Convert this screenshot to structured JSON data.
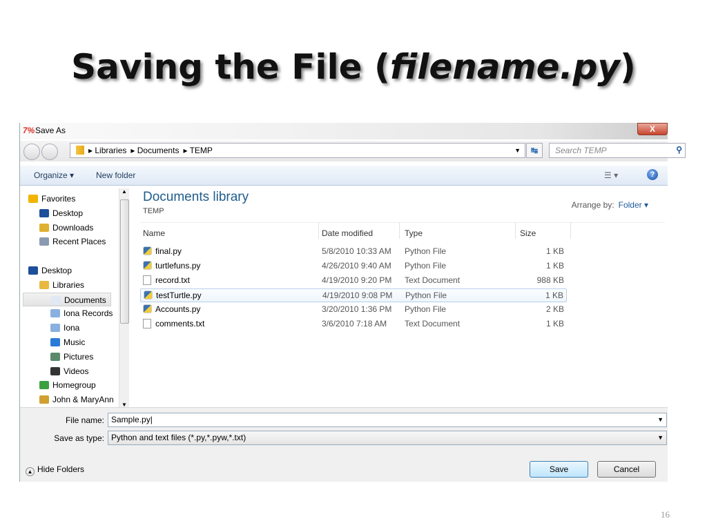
{
  "slide": {
    "title_main": "Saving the File (",
    "title_italic": "filename.py",
    "title_end": ")",
    "page_number": "16"
  },
  "dialog": {
    "title": "Save As",
    "app_icon": "7%",
    "close": "X",
    "breadcrumb": [
      "Libraries",
      "Documents",
      "TEMP"
    ],
    "search_placeholder": "Search TEMP",
    "toolbar": {
      "organize": "Organize ▾",
      "new_folder": "New folder",
      "help": "?"
    },
    "sidebar": [
      {
        "label": "Favorites",
        "indent": 0,
        "color": "#f2b400"
      },
      {
        "label": "Desktop",
        "indent": 1,
        "color": "#1d4f9a"
      },
      {
        "label": "Downloads",
        "indent": 1,
        "color": "#e0b030"
      },
      {
        "label": "Recent Places",
        "indent": 1,
        "color": "#8a9ab0"
      },
      {
        "label": "",
        "indent": 0,
        "color": ""
      },
      {
        "label": "Desktop",
        "indent": 0,
        "color": "#1d4f9a"
      },
      {
        "label": "Libraries",
        "indent": 1,
        "color": "#e8b840"
      },
      {
        "label": "Documents",
        "indent": 2,
        "color": "#dfe8f4",
        "selected": true
      },
      {
        "label": "Iona Records",
        "indent": 2,
        "color": "#8ab0e0"
      },
      {
        "label": "Iona",
        "indent": 2,
        "color": "#8ab0e0"
      },
      {
        "label": "Music",
        "indent": 2,
        "color": "#2a7ad8"
      },
      {
        "label": "Pictures",
        "indent": 2,
        "color": "#5a8a6a"
      },
      {
        "label": "Videos",
        "indent": 2,
        "color": "#333"
      },
      {
        "label": "Homegroup",
        "indent": 1,
        "color": "#3aa040"
      },
      {
        "label": "John & MaryAnn",
        "indent": 1,
        "color": "#d0a030"
      }
    ],
    "library": {
      "title": "Documents library",
      "subtitle": "TEMP",
      "arrange_label": "Arrange by:",
      "arrange_value": "Folder ▾"
    },
    "columns": [
      "Name",
      "Date modified",
      "Type",
      "Size"
    ],
    "files": [
      {
        "name": "final.py",
        "date": "5/8/2010 10:33 AM",
        "type": "Python File",
        "size": "1 KB",
        "icon": "python"
      },
      {
        "name": "turtlefuns.py",
        "date": "4/26/2010 9:40 AM",
        "type": "Python File",
        "size": "1 KB",
        "icon": "python"
      },
      {
        "name": "record.txt",
        "date": "4/19/2010 9:20 PM",
        "type": "Text Document",
        "size": "988 KB",
        "icon": "text"
      },
      {
        "name": "testTurtle.py",
        "date": "4/19/2010 9:08 PM",
        "type": "Python File",
        "size": "1 KB",
        "icon": "python",
        "selected": true
      },
      {
        "name": "Accounts.py",
        "date": "3/20/2010 1:36 PM",
        "type": "Python File",
        "size": "2 KB",
        "icon": "python"
      },
      {
        "name": "comments.txt",
        "date": "3/6/2010 7:18 AM",
        "type": "Text Document",
        "size": "1 KB",
        "icon": "text"
      }
    ],
    "file_name_label": "File name:",
    "file_name_value": "Sample.py",
    "save_type_label": "Save as type:",
    "save_type_value": "Python and text files (*.py,*.pyw,*.txt)",
    "hide_folders": "Hide Folders",
    "save": "Save",
    "cancel": "Cancel"
  }
}
